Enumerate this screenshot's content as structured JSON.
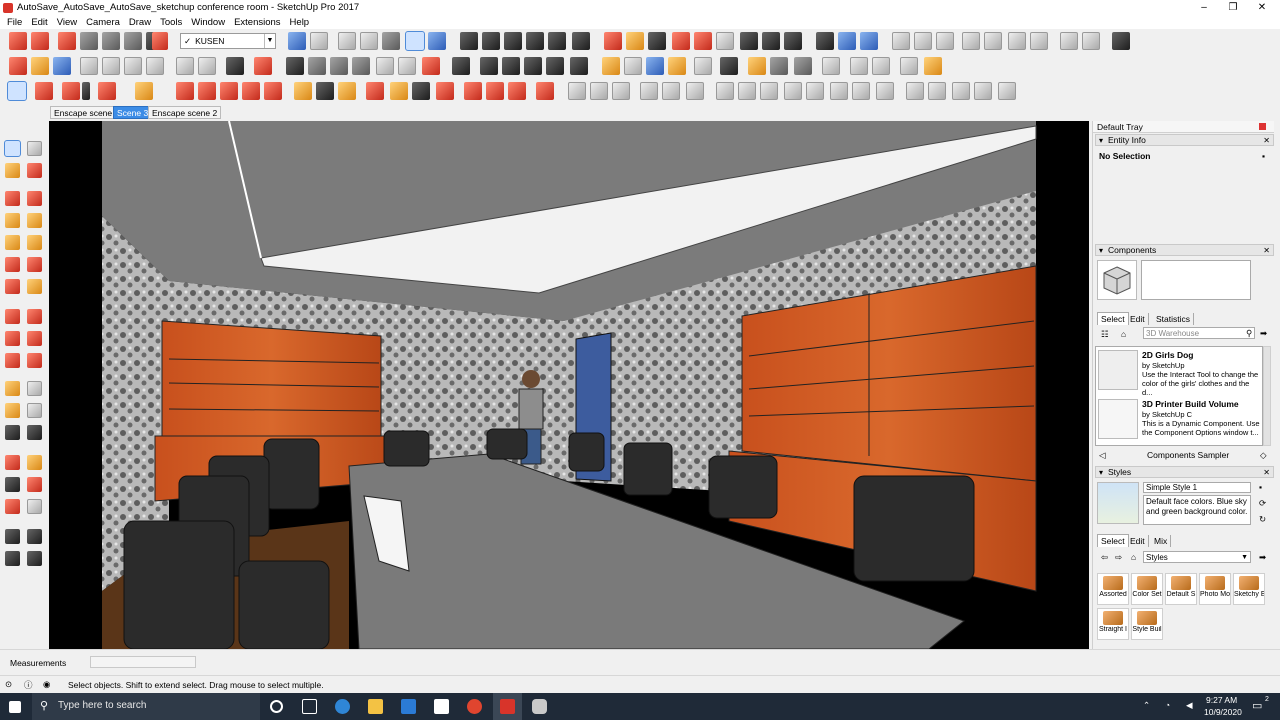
{
  "window": {
    "title": "AutoSave_AutoSave_AutoSave_sketchup conference room - SketchUp Pro 2017"
  },
  "menu": [
    "File",
    "Edit",
    "View",
    "Camera",
    "Draw",
    "Tools",
    "Window",
    "Extensions",
    "Help"
  ],
  "toolbar": {
    "layer_combo": "KUSEN",
    "layer_check": "✓"
  },
  "scenes": [
    "Enscape scene 1",
    "Scene 3",
    "Enscape scene 2"
  ],
  "tray": {
    "title": "Default Tray",
    "entity_info": {
      "header": "Entity Info",
      "selection": "No Selection"
    },
    "components": {
      "header": "Components",
      "tabs": [
        "Select",
        "Edit",
        "Statistics"
      ],
      "search_placeholder": "3D Warehouse",
      "items": [
        {
          "name": "2D Girls Dog",
          "by": "by SketchUp",
          "desc": "Use the Interact Tool to change the color of the girls' clothes and the d..."
        },
        {
          "name": "3D Printer Build Volume",
          "by": "by SketchUp C",
          "desc": "This is a Dynamic Component. Use the Component Options window t..."
        }
      ],
      "sampler": "Components Sampler"
    },
    "styles": {
      "header": "Styles",
      "name": "Simple Style 1",
      "desc": "Default face colors. Blue sky and green background color.",
      "tabs": [
        "Select",
        "Edit",
        "Mix"
      ],
      "collection": "Styles",
      "items": [
        "Assorted",
        "Color Set",
        "Default S",
        "Photo Mo",
        "Sketchy E",
        "Straight I",
        "Style Buil"
      ]
    }
  },
  "measurements": {
    "label": "Measurements"
  },
  "status": {
    "hint": "Select objects. Shift to extend select. Drag mouse to select multiple."
  },
  "taskbar": {
    "search_placeholder": "Type here to search",
    "time": "9:27 AM",
    "date": "10/9/2020",
    "notif_count": "2"
  }
}
